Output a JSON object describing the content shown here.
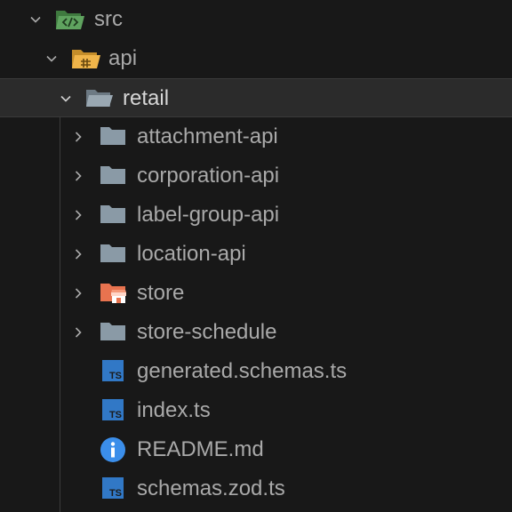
{
  "explorer": {
    "src": {
      "label": "src",
      "icon": "source-folder-open-icon"
    },
    "api": {
      "label": "api",
      "icon": "api-folder-open-icon"
    },
    "retail": {
      "label": "retail",
      "icon": "folder-open-icon"
    },
    "children": [
      {
        "label": "attachment-api",
        "icon": "folder-icon",
        "kind": "folder"
      },
      {
        "label": "corporation-api",
        "icon": "folder-icon",
        "kind": "folder"
      },
      {
        "label": "label-group-api",
        "icon": "folder-icon",
        "kind": "folder"
      },
      {
        "label": "location-api",
        "icon": "folder-icon",
        "kind": "folder"
      },
      {
        "label": "store",
        "icon": "store-folder-icon",
        "kind": "folder"
      },
      {
        "label": "store-schedule",
        "icon": "folder-icon",
        "kind": "folder"
      },
      {
        "label": "generated.schemas.ts",
        "icon": "typescript-file-icon",
        "kind": "file"
      },
      {
        "label": "index.ts",
        "icon": "typescript-file-icon",
        "kind": "file"
      },
      {
        "label": "README.md",
        "icon": "info-icon",
        "kind": "file"
      },
      {
        "label": "schemas.zod.ts",
        "icon": "typescript-file-icon",
        "kind": "file"
      }
    ],
    "colors": {
      "background": "#181818",
      "selected_row": "#2b2b2b",
      "label": "#a9a9a9",
      "folder": "#8a9aa6",
      "source_folder": "#5fa35f",
      "api_folder": "#f0b54a",
      "store_folder": "#e8734f",
      "typescript": "#3178c6",
      "info": "#3b8eea"
    }
  }
}
